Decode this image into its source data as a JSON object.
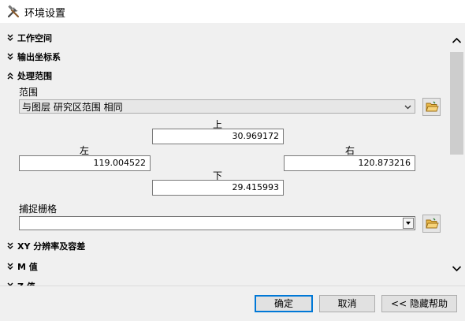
{
  "window": {
    "title": "环境设置"
  },
  "sections": {
    "workspace": "工作空间",
    "output_coords": "输出坐标系",
    "processing_extent": "处理范围",
    "xy_resolution": "XY 分辨率及容差",
    "m_values": "M 值",
    "z_values": "Z 值"
  },
  "extent": {
    "label": "范围",
    "combo_value": "与图层 研究区范围 相同",
    "top_label": "上",
    "top_value": "30.969172",
    "left_label": "左",
    "left_value": "119.004522",
    "right_label": "右",
    "right_value": "120.873216",
    "bottom_label": "下",
    "bottom_value": "29.415993"
  },
  "snap_raster": {
    "label": "捕捉栅格",
    "value": ""
  },
  "buttons": {
    "ok": "确定",
    "cancel": "取消",
    "hide_help": "<< 隐藏帮助"
  }
}
